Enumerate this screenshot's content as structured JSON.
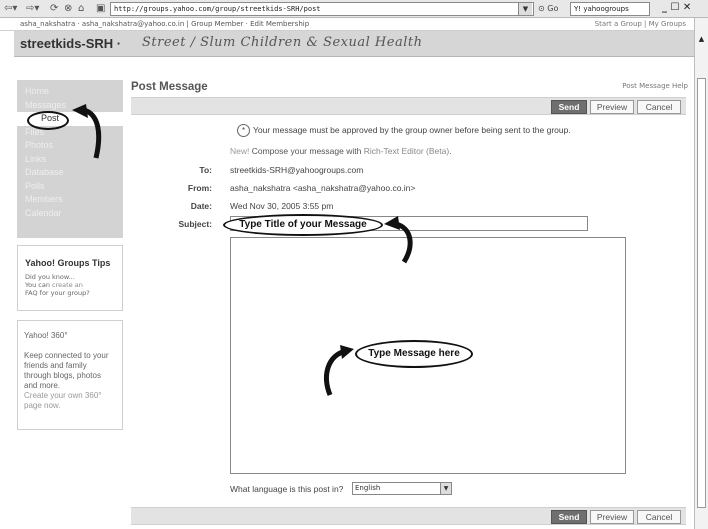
{
  "browser": {
    "url": "http://groups.yahoo.com/group/streetkids-SRH/post",
    "go_label": "Go",
    "search_value": "yahoogroups",
    "win_controls": "_ ☐ ✕"
  },
  "user_strip": {
    "left": "asha_nakshatra · asha_nakshatra@yahoo.co.in | Group Member · Edit Membership",
    "right": "Start a Group | My Groups"
  },
  "group": {
    "name": "streetkids-SRH ·",
    "tagline": "Street / Slum Children & Sexual Health"
  },
  "nav": {
    "items": [
      {
        "label": "Home"
      },
      {
        "label": "Messages"
      },
      {
        "label": "Post"
      },
      {
        "label": "Files"
      },
      {
        "label": "Photos"
      },
      {
        "label": "Links"
      },
      {
        "label": "Database"
      },
      {
        "label": "Polls"
      },
      {
        "label": "Members"
      },
      {
        "label": "Calendar"
      }
    ]
  },
  "tips": {
    "title": "Yahoo! Groups Tips",
    "line1": "Did you know...",
    "line2_a": "You can ",
    "line2_link": "create an",
    "line3": "FAQ for your group?"
  },
  "y360": {
    "title": "Yahoo! 360°",
    "body": "Keep connected to your friends and family through blogs, photos and more.",
    "link": "Create your own 360° page now."
  },
  "page": {
    "title": "Post Message",
    "help": "Post Message Help"
  },
  "actions": {
    "send": "Send",
    "preview": "Preview",
    "cancel": "Cancel"
  },
  "notice": "Your message must be approved by the group owner before being sent to the group.",
  "rte": {
    "new": "New!",
    "text": " Compose your message with ",
    "link": "Rich-Text Editor (Beta)",
    "end": "."
  },
  "form": {
    "to_label": "To:",
    "to_value": "streetkids-SRH@yahoogroups.com",
    "from_label": "From:",
    "from_value": "asha_nakshatra <asha_nakshatra@yahoo.co.in>",
    "date_label": "Date:",
    "date_value": "Wed Nov 30, 2005  3:55 pm",
    "subject_label": "Subject:",
    "subject_value": "",
    "body_value": ""
  },
  "language": {
    "question": "What language is this post in?",
    "selected": "English"
  },
  "annotations": {
    "subject_hint": "Type Title of your Message",
    "body_hint": "Type  Message here"
  }
}
